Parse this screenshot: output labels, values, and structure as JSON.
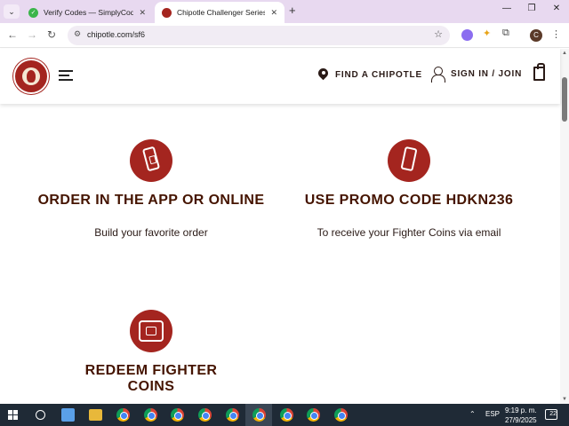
{
  "browser": {
    "tabs": [
      {
        "title": "Verify Codes — SimplyCodes",
        "close": "✕"
      },
      {
        "title": "Chipotle Challenger Series: Stre",
        "close": "✕"
      }
    ],
    "new_tab": "+",
    "window_controls": {
      "minimize": "—",
      "maximize": "❐",
      "close": "✕"
    },
    "url": "chipotle.com/sf6",
    "profile_initial": "C"
  },
  "header": {
    "find_label": "FIND A CHIPOTLE",
    "signin_label": "SIGN IN / JOIN"
  },
  "steps": [
    {
      "title": "ORDER IN THE APP OR ONLINE",
      "subtitle": "Build your favorite order"
    },
    {
      "title": "USE PROMO CODE HDKN236",
      "subtitle": "To receive your Fighter Coins via email"
    },
    {
      "title": "REDEEM FIGHTER COINS"
    }
  ],
  "taskbar": {
    "language": "ESP",
    "time": "9:19 p. m.",
    "date": "27/9/2025",
    "notification_count": "22"
  },
  "colors": {
    "brand_red": "#a4251f",
    "heading_brown": "#451400",
    "tab_bar": "#e8d9f0",
    "taskbar": "#1f2a36"
  }
}
